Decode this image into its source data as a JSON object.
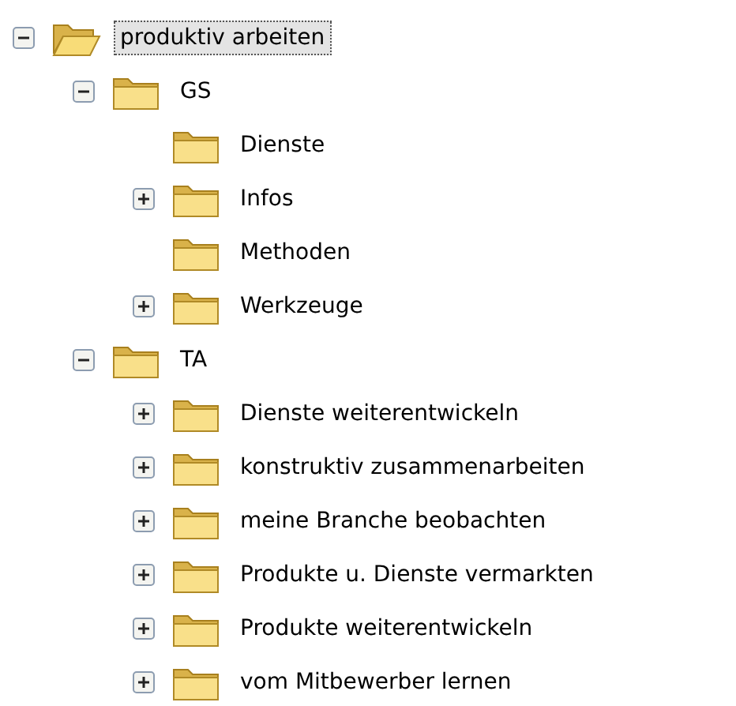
{
  "tree": [
    {
      "label": "produktiv arbeiten",
      "selected": true,
      "expanded": true,
      "children": [
        {
          "label": "GS",
          "selected": false,
          "expanded": true,
          "children": [
            {
              "label": "Dienste",
              "selected": false
            },
            {
              "label": "Infos",
              "selected": false,
              "expanded": false
            },
            {
              "label": "Methoden",
              "selected": false
            },
            {
              "label": "Werkzeuge",
              "selected": false,
              "expanded": false
            }
          ]
        },
        {
          "label": "TA",
          "selected": false,
          "expanded": true,
          "children": [
            {
              "label": "Dienste weiterentwickeln",
              "selected": false,
              "expanded": false
            },
            {
              "label": "konstruktiv zusammenarbeiten",
              "selected": false,
              "expanded": false
            },
            {
              "label": "meine Branche beobachten",
              "selected": false,
              "expanded": false
            },
            {
              "label": "Produkte u. Dienste vermarkten",
              "selected": false,
              "expanded": false
            },
            {
              "label": "Produkte weiterentwickeln",
              "selected": false,
              "expanded": false
            },
            {
              "label": "vom Mitbewerber lernen",
              "selected": false,
              "expanded": false
            }
          ]
        }
      ]
    }
  ]
}
